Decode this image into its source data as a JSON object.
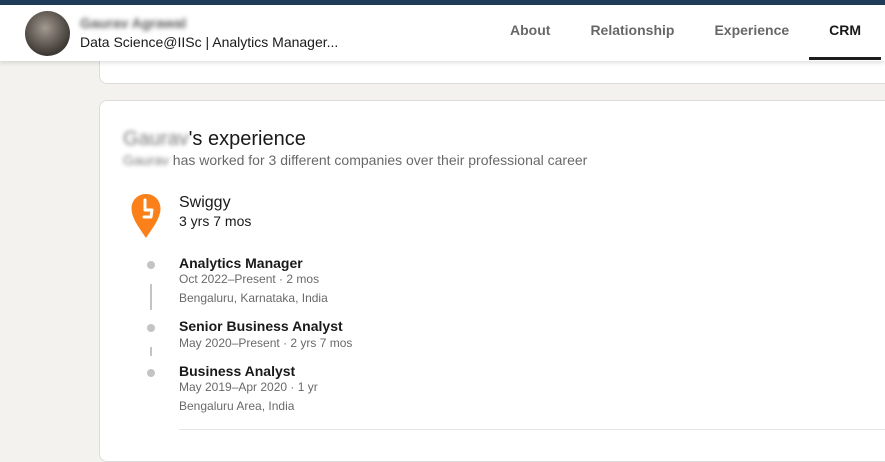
{
  "header": {
    "name": "Gaurav Agrawal",
    "headline": "Data Science@IISc | Analytics Manager...",
    "tabs": [
      {
        "label": "About"
      },
      {
        "label": "Relationship"
      },
      {
        "label": "Experience"
      },
      {
        "label": "CRM"
      }
    ],
    "active_tab": "CRM"
  },
  "experience": {
    "title_name": "Gaurav",
    "title_suffix": "'s experience",
    "subtitle_name": "Gaurav",
    "subtitle_text": " has worked for 3 different companies over their professional career",
    "company": {
      "name": "Swiggy",
      "duration": "3 yrs 7 mos",
      "logo_icon": "swiggy-logo-icon",
      "logo_color": "#fc8019",
      "roles": [
        {
          "title": "Analytics Manager",
          "dates": "Oct 2022–Present · 2 mos",
          "location": "Bengaluru, Karnataka, India"
        },
        {
          "title": "Senior Business Analyst",
          "dates": "May 2020–Present · 2 yrs 7 mos",
          "location": ""
        },
        {
          "title": "Business Analyst",
          "dates": "May 2019–Apr 2020 · 1 yr",
          "location": "Bengaluru Area, India"
        }
      ]
    }
  }
}
